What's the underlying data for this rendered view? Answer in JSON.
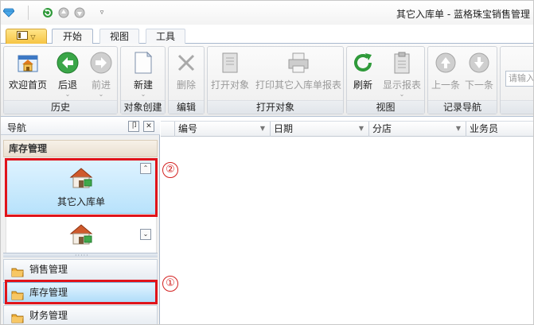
{
  "window": {
    "title": "其它入库单 - 蓝格珠宝销售管理"
  },
  "quick_access": {
    "icons": [
      "app-diamond-icon",
      "refresh-icon",
      "back-icon",
      "forward-icon",
      "dropdown-icon"
    ]
  },
  "ribbon_tabs": {
    "active": "开始",
    "items": [
      {
        "label": "开始"
      },
      {
        "label": "视图"
      },
      {
        "label": "工具"
      }
    ]
  },
  "ribbon": {
    "groups": [
      {
        "label": "历史",
        "buttons": [
          {
            "label": "欢迎首页",
            "icon": "home-icon",
            "enabled": true
          },
          {
            "label": "后退",
            "icon": "back-icon",
            "enabled": true
          },
          {
            "label": "前进",
            "icon": "forward-icon",
            "enabled": false
          }
        ]
      },
      {
        "label": "对象创建",
        "buttons": [
          {
            "label": "新建",
            "icon": "new-document-icon",
            "enabled": true
          }
        ]
      },
      {
        "label": "编辑",
        "buttons": [
          {
            "label": "删除",
            "icon": "delete-icon",
            "enabled": false
          }
        ]
      },
      {
        "label": "打开对象",
        "buttons": [
          {
            "label": "打开对象",
            "icon": "open-object-icon",
            "enabled": false
          },
          {
            "label": "打印其它入库单报表",
            "icon": "printer-icon",
            "enabled": false
          }
        ]
      },
      {
        "label": "视图",
        "buttons": [
          {
            "label": "刷新",
            "icon": "refresh-icon",
            "enabled": true
          },
          {
            "label": "显示报表",
            "icon": "report-icon",
            "enabled": false
          }
        ]
      },
      {
        "label": "记录导航",
        "buttons": [
          {
            "label": "上一条",
            "icon": "previous-record-icon",
            "enabled": false
          },
          {
            "label": "下一条",
            "icon": "next-record-icon",
            "enabled": false
          }
        ]
      }
    ],
    "search_placeholder": "请输入"
  },
  "navigation": {
    "title": "导航",
    "pin_glyph": " 卩",
    "close_glyph": "✕",
    "section_title": "库存管理",
    "big_items": [
      {
        "label": "其它入库单",
        "icon": "house-stock-icon",
        "selected": true
      },
      {
        "label": "",
        "icon": "house-stock-icon",
        "selected": false
      }
    ],
    "menu": [
      {
        "label": "销售管理",
        "active": false
      },
      {
        "label": "库存管理",
        "active": true
      },
      {
        "label": "财务管理",
        "active": false
      }
    ]
  },
  "grid": {
    "columns": [
      {
        "label": "编号"
      },
      {
        "label": "日期"
      },
      {
        "label": "分店"
      },
      {
        "label": "业务员"
      }
    ]
  },
  "annotations": {
    "marker_1": "①",
    "marker_2": "②"
  },
  "colors": {
    "highlight_border": "#e0141b",
    "selected_fill": "#b8e2fb",
    "app_button": "#f6c443"
  }
}
